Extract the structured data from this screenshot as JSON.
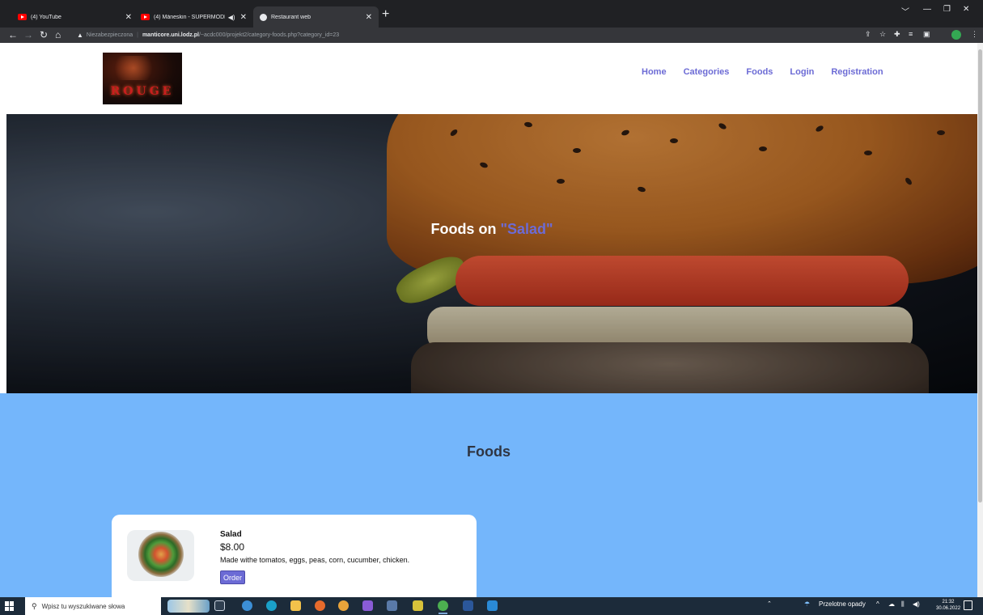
{
  "browser": {
    "tabs": [
      {
        "label": "(4) YouTube",
        "icon": "youtube-icon"
      },
      {
        "label": "(4) Måneskin - SUPERMODE",
        "icon": "youtube-icon"
      },
      {
        "label": "Restaurant web",
        "icon": "globe-icon"
      }
    ],
    "security_label": "Niezabezpieczona",
    "url_host": "manticore.uni.lodz.pl",
    "url_path": "/~acdc000/projekt2/category-foods.php?category_id=23"
  },
  "site": {
    "logo_text": "ROUGE",
    "nav": [
      "Home",
      "Categories",
      "Foods",
      "Login",
      "Registration"
    ],
    "hero": {
      "prefix": "Foods on ",
      "category": "\"Salad\""
    },
    "section_title": "Foods",
    "food": {
      "name": "Salad",
      "price": "$8.00",
      "description": "Made withe tomatos, eggs, peas, corn, cucumber, chicken.",
      "order_label": "Order"
    },
    "colors": {
      "accent": "#6c6bd5",
      "section_bg": "#74b6fb"
    }
  },
  "taskbar": {
    "search_placeholder": "Wpisz tu wyszukiwane słowa",
    "weather": "Przelotne opady",
    "time": "21:32",
    "date": "30.06.2022"
  }
}
